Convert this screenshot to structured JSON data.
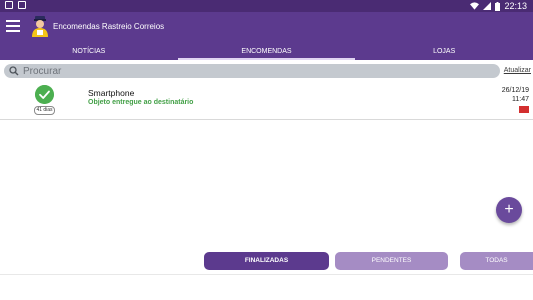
{
  "status_bar": {
    "time": "22:13"
  },
  "app_bar": {
    "title": "Encomendas Rastreio Correios"
  },
  "tabs": [
    {
      "label": "NOTÍCIAS",
      "active": false
    },
    {
      "label": "ENCOMENDAS",
      "active": true
    },
    {
      "label": "LOJAS",
      "active": false
    }
  ],
  "search": {
    "placeholder": "Procurar",
    "refresh_label": "Atualizar"
  },
  "packages": [
    {
      "name": "Smartphone",
      "status": "Objeto entregue ao destinatário",
      "days": "41 dias",
      "date": "26/12/19",
      "time": "11:47"
    }
  ],
  "fab": {
    "label": "+"
  },
  "filters": {
    "finalized": "FINALIZADAS",
    "pending": "PENDENTES",
    "all": "TODAS"
  },
  "colors": {
    "primary": "#5c3a8e",
    "status_bar": "#4a2b73",
    "delivered": "#4caf50",
    "inactive_filter": "#a58cc4"
  }
}
